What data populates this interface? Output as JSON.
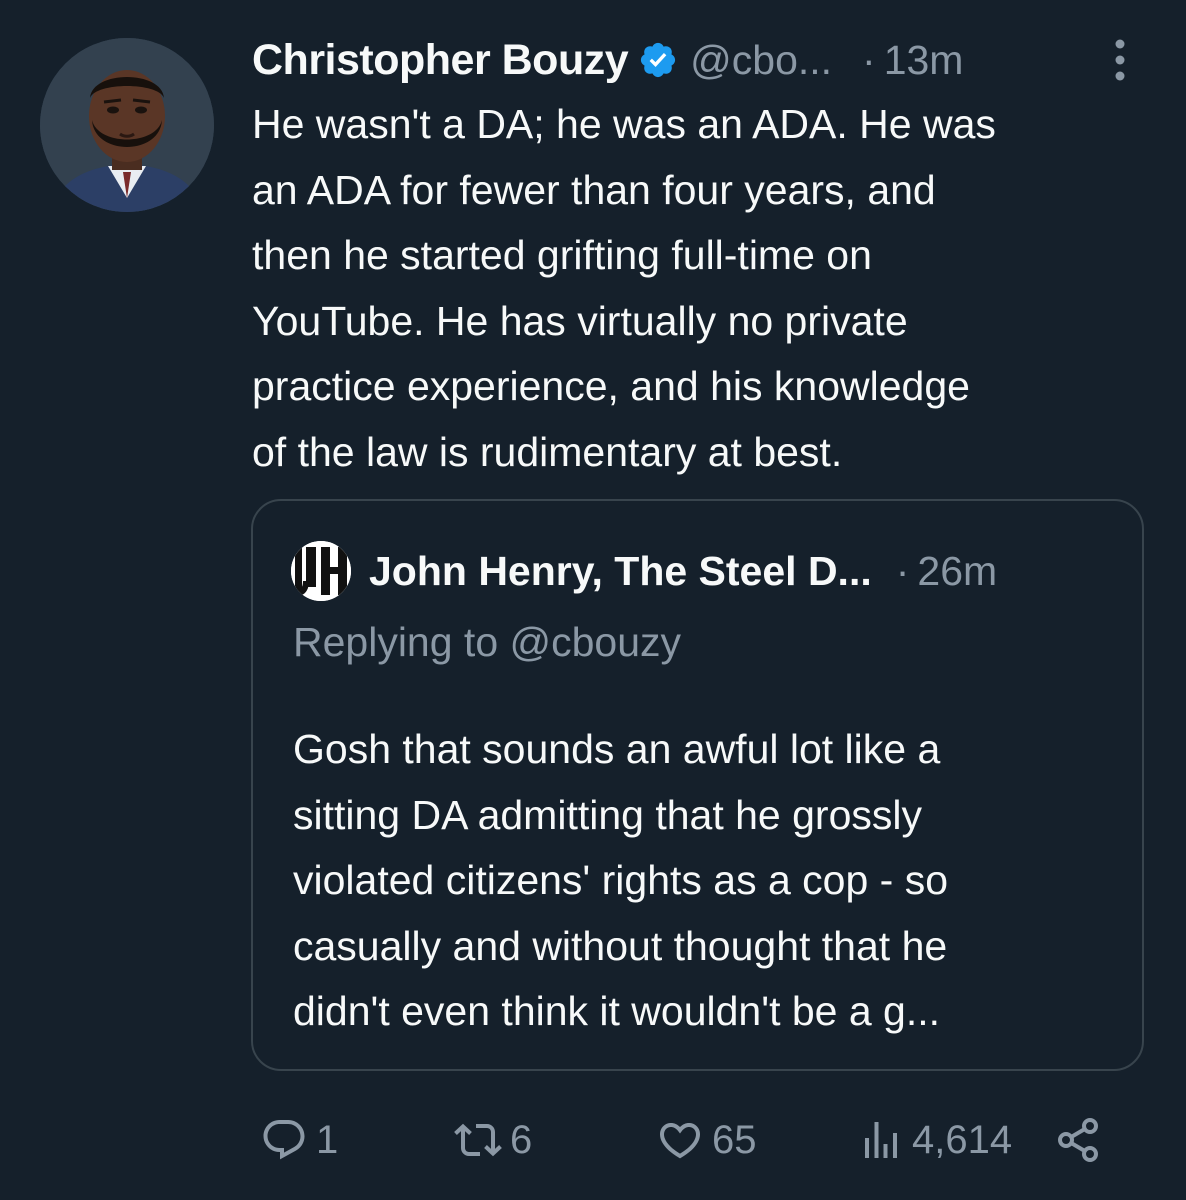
{
  "author": {
    "name": "Christopher Bouzy",
    "handle": "@cbo...",
    "time_dot": "·",
    "time": "13m",
    "avatar_icon": "user-avatar-photo",
    "verified_icon": "verified-badge-icon"
  },
  "tweet_lines": [
    "He wasn't a DA; he was an ADA. He was",
    "an ADA for fewer than four years, and",
    "then he started grifting full-time on",
    "YouTube. He has virtually no private",
    "practice experience, and his knowledge",
    "of the law is rudimentary at best."
  ],
  "quoted": {
    "name": "John Henry, The Steel D...",
    "time_dot": "·",
    "time": "26m",
    "replying_to": "Replying to @cbouzy",
    "text_lines": [
      "Gosh that sounds an awful lot like a",
      "sitting DA admitting that he grossly",
      "violated citizens' rights as a cop - so",
      "casually and without thought that he",
      "didn't even think it wouldn't be a g..."
    ]
  },
  "actions": {
    "replies": "1",
    "retweets": "6",
    "likes": "65",
    "views": "4,614"
  },
  "colors": {
    "background": "#15202b",
    "text": "#f7f9f9",
    "muted": "#8b98a5",
    "border": "#38444d",
    "verified": "#1d9bf0"
  }
}
